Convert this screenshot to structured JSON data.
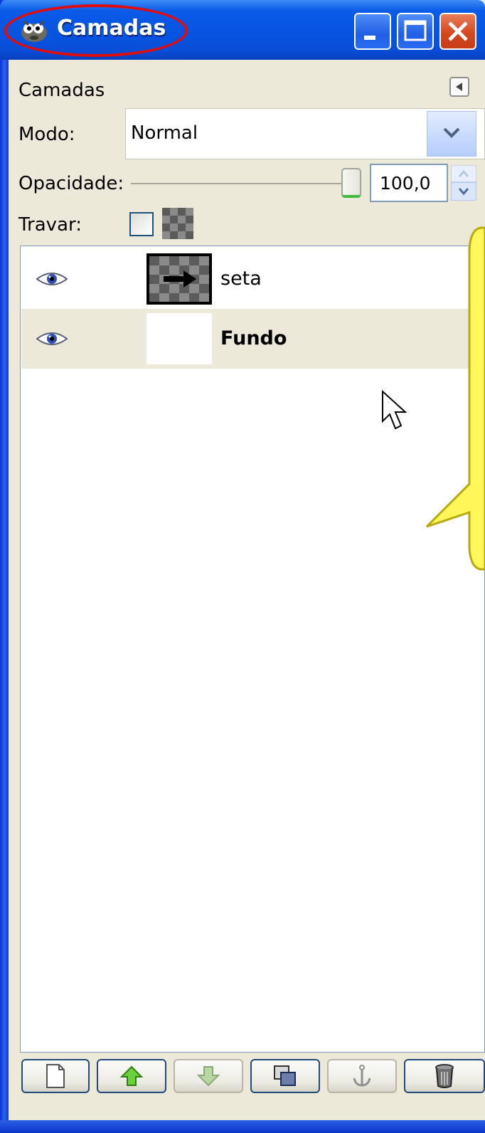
{
  "window": {
    "title": "Camadas"
  },
  "pane": {
    "tab_label": "Camadas",
    "mode_label": "Modo:",
    "mode_value": "Normal",
    "opacity_label": "Opacidade:",
    "opacity_value": "100,0",
    "lock_label": "Travar:"
  },
  "layers": [
    {
      "name": "seta",
      "visible": true,
      "active": false
    },
    {
      "name": "Fundo",
      "visible": true,
      "active": true
    }
  ],
  "toolbar": {
    "buttons": [
      {
        "icon": "new-layer-icon",
        "enabled": true
      },
      {
        "icon": "raise-layer-icon",
        "enabled": true
      },
      {
        "icon": "lower-layer-icon",
        "enabled": false
      },
      {
        "icon": "duplicate-layer-icon",
        "enabled": true
      },
      {
        "icon": "anchor-layer-icon",
        "enabled": false
      },
      {
        "icon": "delete-layer-icon",
        "enabled": true
      }
    ]
  },
  "colors": {
    "title_bar": "#0654e0",
    "close_button": "#d4451b",
    "annotation_ellipse": "#e00d0d",
    "callout_fill": "#fff65a",
    "selected_row": "#ece9d8"
  }
}
